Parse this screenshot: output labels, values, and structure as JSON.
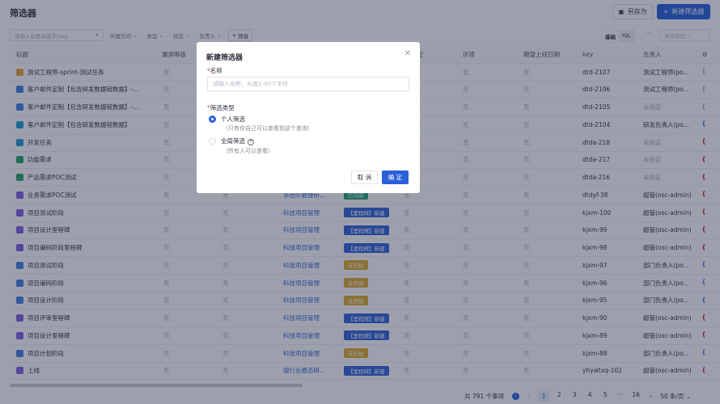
{
  "page": {
    "title": "筛选器",
    "save_as": "另存为",
    "new_filter": "新建筛选器"
  },
  "toolbar": {
    "search_placeholder": "请输入标题关键字/key",
    "filters": [
      "所属空间",
      "类型",
      "状态",
      "负责人"
    ],
    "add_filter": "筛选",
    "mode_basic": "基础",
    "mode_iql": "IQL",
    "more": "···",
    "view": "事项视图"
  },
  "columns": [
    "标题",
    "漏洞等级",
    "",
    "",
    "",
    "通过",
    "环境",
    "期望上线日期",
    "key",
    "负责人"
  ],
  "rows": [
    {
      "title": "测试工程师-sprint-测试任务",
      "icon": "#e8a33a",
      "level": "无",
      "env": "无",
      "date": "无",
      "key": "dtd-2107",
      "owner": "测试工程师(po...",
      "owner_muted": false,
      "mark": "#aab"
    },
    {
      "title": "客户邮件定制【包含研发数据链数据】-...",
      "icon": "#3f7fe0",
      "level": "无",
      "env": "无",
      "date": "无",
      "key": "dtd-2106",
      "owner": "测试工程师(po...",
      "owner_muted": false,
      "mark": "#aab"
    },
    {
      "title": "客户邮件定制【包含研发数据链数据】-...",
      "icon": "#3f7fe0",
      "level": "无",
      "env": "无",
      "date": "无",
      "key": "dtd-2105",
      "owner": "未指定",
      "owner_muted": true,
      "mark": "#aab"
    },
    {
      "title": "客户邮件定制【包含研发数据链数据】",
      "icon": "#1a9ad6",
      "level": "无",
      "env": "无",
      "date": "无",
      "key": "dtd-2104",
      "owner": "研发负责人(po...",
      "owner_muted": false,
      "mark": "#3f7fe0"
    },
    {
      "title": "开发任务",
      "icon": "#1a9ad6",
      "level": "无",
      "env": "无",
      "date": "无",
      "key": "dtda-218",
      "owner": "未指定",
      "owner_muted": true,
      "mark": "#c0283a"
    },
    {
      "title": "功能需求",
      "icon": "#22a06b",
      "level": "无",
      "env": "无",
      "date": "无",
      "key": "dtda-217",
      "owner": "未指定",
      "owner_muted": true,
      "mark": "#c0283a"
    },
    {
      "title": "产品需求POC测试",
      "icon": "#22a06b",
      "level": "无",
      "env": "无",
      "date": "无",
      "key": "dtda-216",
      "owner": "未指定",
      "owner_muted": true,
      "mark": "#c0283a"
    },
    {
      "title": "业务需求POC测试",
      "icon": "#7b5ce0",
      "level": "无",
      "c3": "无",
      "space": "多团队敏捷研...",
      "status": "已完成",
      "status_color": "#1ea672",
      "pass": "无",
      "env": "无",
      "date": "无",
      "key": "dtdyf-38",
      "owner": "超管(osc-admin)",
      "owner_muted": false,
      "mark": "#c0283a"
    },
    {
      "title": "项目测试阶段",
      "icon": "#7b5ce0",
      "level": "无",
      "c3": "无",
      "space": "科技项目管理",
      "status": "【里程碑】新建",
      "status_color": "#2b5fd9",
      "pass": "无",
      "env": "无",
      "date": "无",
      "key": "kjxm-100",
      "owner": "超管(osc-admin)",
      "owner_muted": false,
      "mark": "#c0283a"
    },
    {
      "title": "项目设计里程碑",
      "icon": "#7b5ce0",
      "level": "无",
      "c3": "无",
      "space": "科技项目管理",
      "status": "【里程碑】新建",
      "status_color": "#2b5fd9",
      "pass": "无",
      "env": "无",
      "date": "无",
      "key": "kjxm-99",
      "owner": "超管(osc-admin)",
      "owner_muted": false,
      "mark": "#c0283a"
    },
    {
      "title": "项目编码阶段里程碑",
      "icon": "#7b5ce0",
      "level": "无",
      "c3": "无",
      "space": "科技项目管理",
      "status": "【里程碑】新建",
      "status_color": "#2b5fd9",
      "pass": "无",
      "env": "无",
      "date": "无",
      "key": "kjxm-98",
      "owner": "超管(osc-admin)",
      "owner_muted": false,
      "mark": "#c0283a"
    },
    {
      "title": "项目测试阶段",
      "icon": "#3f7fe0",
      "level": "无",
      "c3": "无",
      "space": "科技项目管理",
      "status": "未开始",
      "status_color": "#e0a92a",
      "pass": "无",
      "env": "无",
      "date": "无",
      "key": "kjxm-97",
      "owner": "部门负责人(po...",
      "owner_muted": false,
      "mark": "#3f7fe0"
    },
    {
      "title": "项目编码阶段",
      "icon": "#3f7fe0",
      "level": "无",
      "c3": "无",
      "space": "科技项目管理",
      "status": "未开始",
      "status_color": "#e0a92a",
      "pass": "无",
      "env": "无",
      "date": "无",
      "key": "kjxm-96",
      "owner": "部门负责人(po...",
      "owner_muted": false,
      "mark": "#3f7fe0"
    },
    {
      "title": "项目设计阶段",
      "icon": "#3f7fe0",
      "level": "无",
      "c3": "无",
      "space": "科技项目管理",
      "status": "未开始",
      "status_color": "#e0a92a",
      "pass": "无",
      "env": "无",
      "date": "无",
      "key": "kjxm-95",
      "owner": "部门负责人(po...",
      "owner_muted": false,
      "mark": "#3f7fe0"
    },
    {
      "title": "项目评审里程碑",
      "icon": "#7b5ce0",
      "level": "无",
      "c3": "无",
      "space": "科技项目管理",
      "status": "【里程碑】新建",
      "status_color": "#2b5fd9",
      "pass": "无",
      "env": "无",
      "date": "无",
      "key": "kjxm-90",
      "owner": "超管(osc-admin)",
      "owner_muted": false,
      "mark": "#c0283a"
    },
    {
      "title": "项目设计里程碑",
      "icon": "#7b5ce0",
      "level": "无",
      "c3": "无",
      "space": "科技项目管理",
      "status": "【里程碑】新建",
      "status_color": "#2b5fd9",
      "pass": "无",
      "env": "无",
      "date": "无",
      "key": "kjxm-89",
      "owner": "超管(osc-admin)",
      "owner_muted": false,
      "mark": "#c0283a"
    },
    {
      "title": "项目计划阶段",
      "icon": "#3f7fe0",
      "level": "无",
      "c3": "无",
      "space": "科技项目管理",
      "status": "未开始",
      "status_color": "#e0a92a",
      "pass": "无",
      "env": "无",
      "date": "无",
      "key": "kjxm-88",
      "owner": "部门负责人(po...",
      "owner_muted": false,
      "mark": "#3f7fe0"
    },
    {
      "title": "上线",
      "icon": "#7b5ce0",
      "level": "无",
      "c3": "无",
      "space": "银行业稳态研...",
      "status": "【里程碑】新建",
      "status_color": "#2b5fd9",
      "pass": "无",
      "env": "无",
      "date": "无",
      "key": "yhywtxq-102",
      "owner": "超管(osc-admin)",
      "owner_muted": false,
      "mark": "#c0283a"
    }
  ],
  "footer": {
    "total": "共 791 个事项",
    "pages": [
      "1",
      "2",
      "3",
      "4",
      "5",
      "···",
      "16"
    ],
    "page_size": "50 条/页"
  },
  "modal": {
    "title": "新建筛选器",
    "name_label": "名称",
    "name_placeholder": "请输入名称，长度1-40个字符",
    "type_label": "筛选类型",
    "personal": "个人筛选",
    "personal_desc": "（只有你自己可以查看到这个查询）",
    "global": "全局筛选",
    "global_desc": "（所有人可以查看）",
    "cancel": "取 消",
    "ok": "确 定"
  }
}
